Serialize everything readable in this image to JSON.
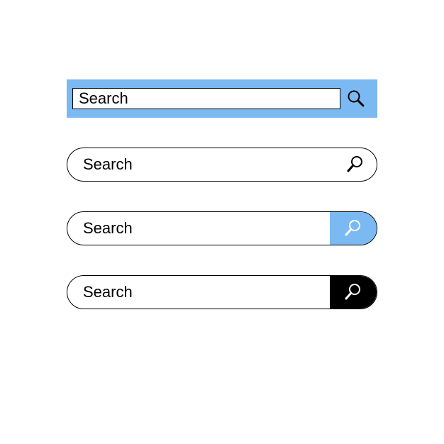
{
  "colors": {
    "blue": "#7ab9f2",
    "black": "#000000",
    "white": "#ffffff"
  },
  "searchbars": {
    "v1": {
      "placeholder": "Search"
    },
    "v2": {
      "placeholder": "Search"
    },
    "v3": {
      "placeholder": "Search"
    },
    "v4": {
      "placeholder": "Search"
    }
  }
}
